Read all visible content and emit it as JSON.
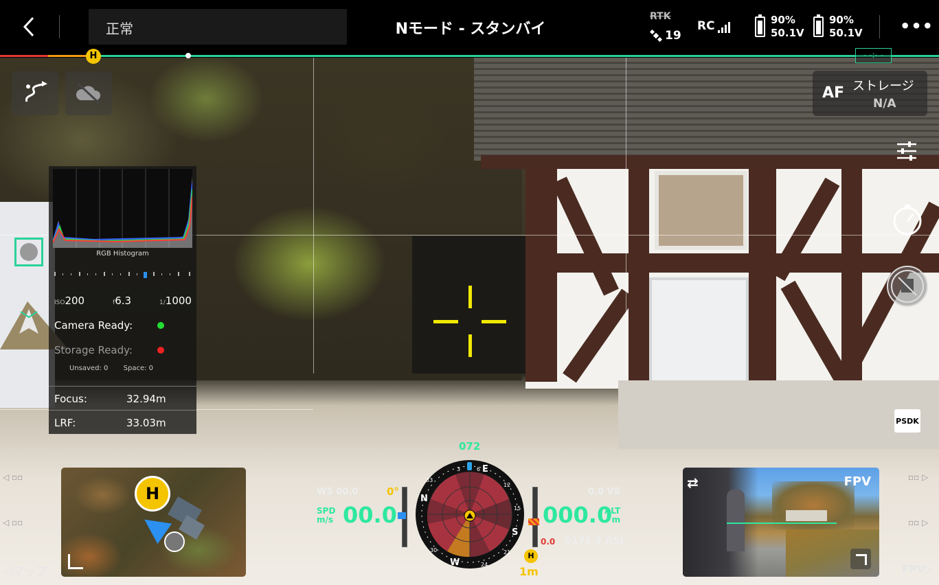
{
  "topbar": {
    "status": "正常",
    "mode": "Nモード - スタンバイ",
    "rtk_label": "RTK",
    "satellites": "19",
    "rc_label": "RC",
    "battery1": {
      "percent": "90%",
      "voltage": "50.1V"
    },
    "battery2": {
      "percent": "90%",
      "voltage": "50.1V"
    },
    "more_icon": "more-dots-icon"
  },
  "progress": {
    "home_marker": "H",
    "colors": {
      "red": "#e53935",
      "orange": "#f39c12",
      "green": "#2ad29a"
    }
  },
  "camera": {
    "af_label": "AF",
    "storage_label": "ストレージ",
    "storage_value": "N/A"
  },
  "histogram": {
    "title": "RGB Histogram",
    "iso_label": "ISO",
    "iso": "200",
    "aperture_label": "f",
    "aperture": "6.3",
    "shutter_label": "1/",
    "shutter": "1000",
    "camera_ready": "Camera Ready:",
    "storage_ready": "Storage Ready:",
    "unsaved_label": "Unsaved:",
    "unsaved": "0",
    "space_label": "Space:",
    "space": "0",
    "focus_label": "Focus:",
    "focus": "32.94m",
    "lrf_label": "LRF:",
    "lrf": "33.03m"
  },
  "flight": {
    "ws_label": "WS",
    "ws": "00.0",
    "gimbal_angle": "0°",
    "spd_label1": "SPD",
    "spd_label2": "m/s",
    "speed": "00.0",
    "heading": "072",
    "compass": {
      "n": "N",
      "e": "E",
      "s": "S",
      "w": "W",
      "t3": "3",
      "t6": "6",
      "t12": "12",
      "t15": "15",
      "t21": "21",
      "t24": "24",
      "t30": "30",
      "t33": "33"
    },
    "home_dist_marker": "H",
    "home_distance": "1m",
    "altitude": "000.0",
    "alt_label1": "ALT",
    "alt_label2": "m",
    "vs_value": "0.0",
    "vs_label": "VS",
    "vs_small": "0.0",
    "asl": "0171.3 ASL"
  },
  "bottom": {
    "map_label": "マップ",
    "fpv_label": "FPV",
    "fpv_title": "FPV",
    "psdk_label": "PSDK",
    "map_home": "H"
  }
}
